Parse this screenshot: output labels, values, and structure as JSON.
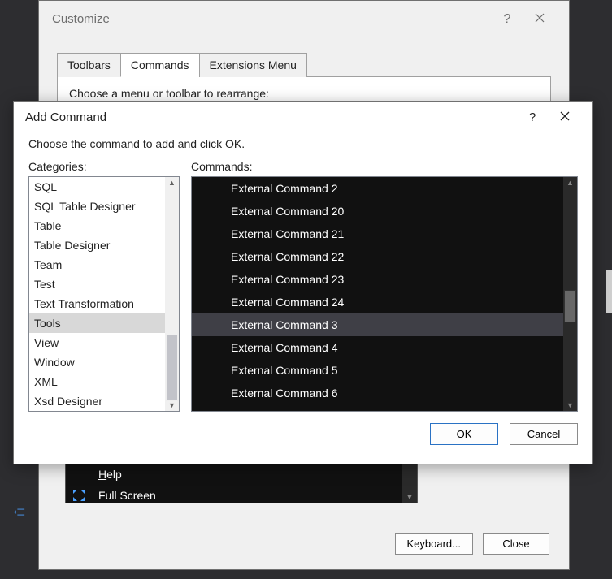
{
  "customizeDialog": {
    "title": "Customize",
    "tabs": [
      "Toolbars",
      "Commands",
      "Extensions Menu"
    ],
    "activeTab": 1,
    "chooseLabel": "Choose a menu or toolbar to rearrange:",
    "visibleListRows": [
      {
        "icon": "",
        "label": "Help",
        "underline": "H"
      },
      {
        "icon": "fullscreen",
        "label": "Full Screen",
        "underline": ""
      }
    ],
    "buttons": {
      "keyboard": "Keyboard...",
      "close": "Close"
    }
  },
  "addCommandDialog": {
    "title": "Add Command",
    "intro": "Choose the command to add and click OK.",
    "categoriesLabel": "Categories:",
    "commandsLabel": "Commands:",
    "categories": [
      "SQL",
      "SQL Table Designer",
      "Table",
      "Table Designer",
      "Team",
      "Test",
      "Text Transformation",
      "Tools",
      "View",
      "Window",
      "XML",
      "Xsd Designer"
    ],
    "selectedCategoryIndex": 7,
    "commands": [
      "External Command 2",
      "External Command 20",
      "External Command 21",
      "External Command 22",
      "External Command 23",
      "External Command 24",
      "External Command 3",
      "External Command 4",
      "External Command 5",
      "External Command 6"
    ],
    "selectedCommandIndex": 6,
    "buttons": {
      "ok": "OK",
      "cancel": "Cancel"
    }
  }
}
